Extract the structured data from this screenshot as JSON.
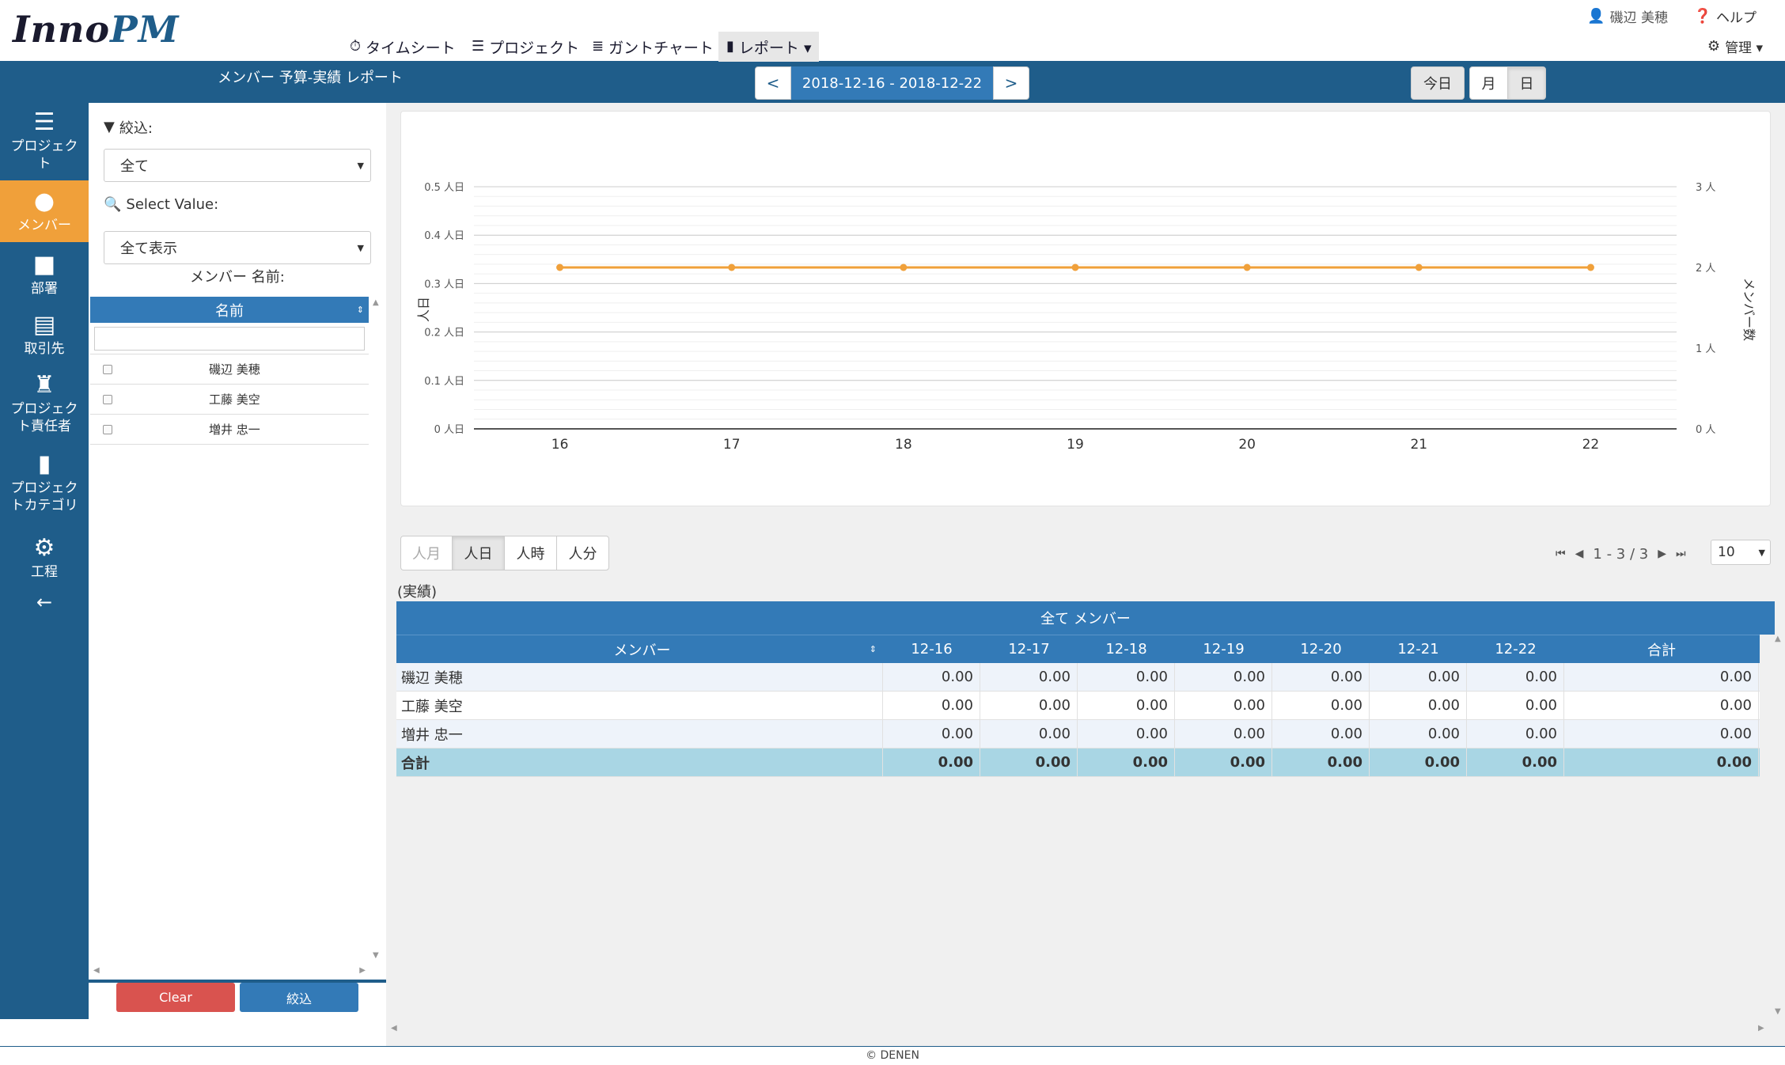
{
  "app": {
    "logo_main": "Inno",
    "logo_accent": "PM"
  },
  "topnav": [
    {
      "icon": "⏱",
      "label": "タイムシート"
    },
    {
      "icon": "☰",
      "label": "プロジェクト"
    },
    {
      "icon": "≣",
      "label": "ガントチャート"
    },
    {
      "icon": "▮",
      "label": "レポート ▾"
    }
  ],
  "user": {
    "name": "磯辺 美穂",
    "help": "ヘルプ",
    "admin": "管理 ▾"
  },
  "toolbar": {
    "report_title": "メンバー 予算-実績 レポート",
    "prev": "<",
    "next": ">",
    "date_range": "2018-12-16 - 2018-12-22",
    "today": "今日",
    "month": "月",
    "day": "日"
  },
  "sidebar": [
    {
      "icon": "☰",
      "label": "プロジェク\nト"
    },
    {
      "icon": "●",
      "label": "メンバー"
    },
    {
      "icon": "■",
      "label": "部署"
    },
    {
      "icon": "▤",
      "label": "取引先"
    },
    {
      "icon": "♜",
      "label": "プロジェク\nト責任者"
    },
    {
      "icon": "▮",
      "label": "プロジェク\nトカテゴリ"
    },
    {
      "icon": "⚙",
      "label": "工程"
    },
    {
      "icon": "←",
      "label": ""
    }
  ],
  "filter": {
    "narrow_label": "絞込:",
    "narrow_value": "全て",
    "select_label": "Select Value:",
    "select_value": "全て表示",
    "name_label": "メンバー 名前:",
    "grid_header": "名前",
    "names": [
      "磯辺 美穂",
      "工藤 美空",
      "増井 忠一"
    ],
    "clear": "Clear",
    "apply": "絞込"
  },
  "chart_data": {
    "type": "line",
    "x": [
      "16",
      "17",
      "18",
      "19",
      "20",
      "21",
      "22"
    ],
    "series": [
      {
        "axis": "right",
        "values": [
          2,
          2,
          2,
          2,
          2,
          2,
          2
        ],
        "color": "#f0a03a"
      }
    ],
    "left_axis": {
      "label": "人日",
      "ticks": [
        "0 人日",
        "0.1 人日",
        "0.2 人日",
        "0.3 人日",
        "0.4 人日",
        "0.5 人日"
      ],
      "ylim": [
        0,
        0.5
      ]
    },
    "right_axis": {
      "label": "メンバー数",
      "ticks": [
        "0 人",
        "1 人",
        "2 人",
        "3 人"
      ],
      "ylim": [
        0,
        3
      ]
    },
    "grid": true
  },
  "units": {
    "buttons": [
      "人月",
      "人日",
      "人時",
      "人分"
    ],
    "active": "人日"
  },
  "pager": {
    "first": "⏮",
    "prev": "◀",
    "text": "1 - 3 / 3",
    "next": "▶",
    "last": "⏭",
    "page_size": "10"
  },
  "result_label": "(実績)",
  "table": {
    "title": "全て メンバー",
    "headers": [
      "メンバー",
      "12-16",
      "12-17",
      "12-18",
      "12-19",
      "12-20",
      "12-21",
      "12-22",
      "合計"
    ],
    "rows": [
      {
        "name": "磯辺 美穂",
        "values": [
          "0.00",
          "0.00",
          "0.00",
          "0.00",
          "0.00",
          "0.00",
          "0.00",
          "0.00"
        ]
      },
      {
        "name": "工藤 美空",
        "values": [
          "0.00",
          "0.00",
          "0.00",
          "0.00",
          "0.00",
          "0.00",
          "0.00",
          "0.00"
        ]
      },
      {
        "name": "増井 忠一",
        "values": [
          "0.00",
          "0.00",
          "0.00",
          "0.00",
          "0.00",
          "0.00",
          "0.00",
          "0.00"
        ]
      }
    ],
    "total": {
      "name": "合計",
      "values": [
        "0.00",
        "0.00",
        "0.00",
        "0.00",
        "0.00",
        "0.00",
        "0.00",
        "0.00"
      ]
    }
  },
  "footer": "© DENEN",
  "colors": {
    "brand": "#1f5d8a",
    "accent": "#f0a03a",
    "header_blue": "#337ab7",
    "danger": "#d9534f",
    "total_row": "#a9d6e4"
  }
}
